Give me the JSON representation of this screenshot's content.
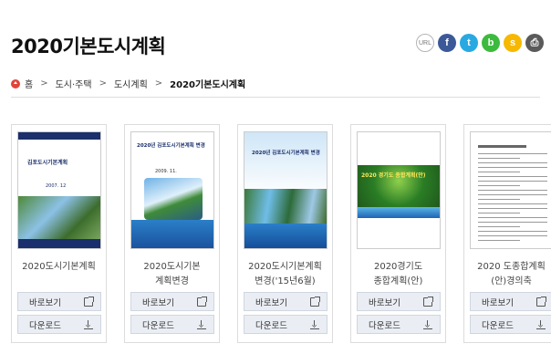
{
  "page_title": "2020기본도시계획",
  "share": {
    "url": "URL",
    "facebook": "f",
    "twitter": "t",
    "band": "b",
    "kakaostory": "s",
    "print": "⎙"
  },
  "breadcrumb": {
    "home": "홈",
    "level1": "도시·주택",
    "level2": "도시계획",
    "current": "2020기본도시계획",
    "separator": ">"
  },
  "buttons": {
    "view": "바로보기",
    "download": "다운로드"
  },
  "cards": [
    {
      "title_line1": "2020도시기본계획",
      "title_line2": "",
      "cover_label": "김포도시기본계획",
      "cover_year": "2007. 12"
    },
    {
      "title_line1": "2020도시기본",
      "title_line2": "계획변경",
      "cover_label": "2020년 김포도시기본계획 변경",
      "cover_year": "2009. 11."
    },
    {
      "title_line1": "2020도시기본계획",
      "title_line2": "변경('15년6월)",
      "cover_label": "2020년 김포도시기본계획 변경",
      "cover_year": ""
    },
    {
      "title_line1": "2020경기도",
      "title_line2": "종합계획(안)",
      "cover_label": "2020 경기도 종합계획(안)",
      "cover_year": ""
    },
    {
      "title_line1": "2020 도종합계획",
      "title_line2": "(안)경의축",
      "cover_label": "",
      "cover_year": ""
    }
  ],
  "colors": {
    "button_bg": "#eaeef4",
    "home_icon": "#e0453a",
    "facebook": "#3b5998",
    "twitter": "#29a9e1",
    "band": "#3dba3d",
    "story": "#f6b800"
  }
}
